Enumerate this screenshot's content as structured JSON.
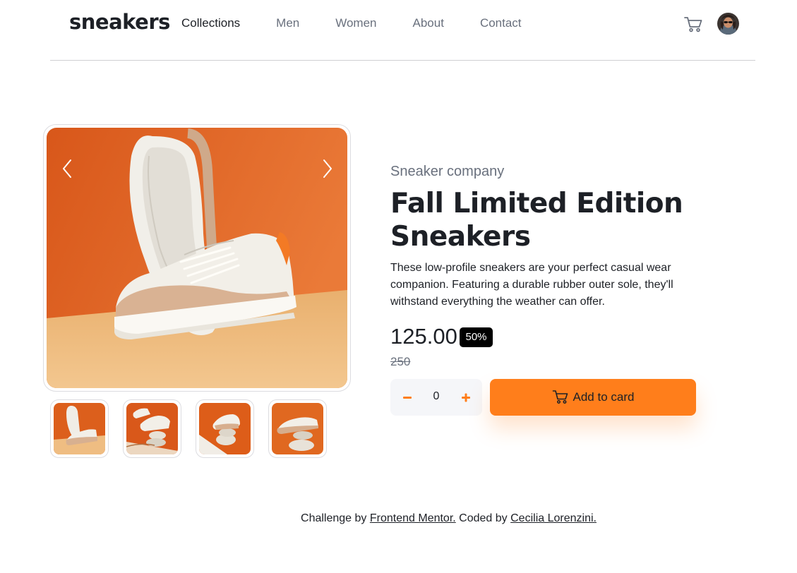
{
  "header": {
    "logo": "sneakers",
    "nav": [
      "Collections",
      "Men",
      "Women",
      "About",
      "Contact"
    ],
    "active_nav": "Collections"
  },
  "gallery": {
    "thumbnail_count": 4,
    "selected_thumbnail": 1
  },
  "product": {
    "company": "Sneaker company",
    "title": "Fall Limited Edition Sneakers",
    "description": "These low-profile sneakers are your perfect casual wear companion. Featuring a durable rubber outer sole, they'll withstand everything the weather can offer.",
    "price": "125.00",
    "discount": "50%",
    "original_price": "250",
    "quantity": "0",
    "add_button": "Add to card"
  },
  "footer": {
    "prefix": "Challenge by",
    "link1": "Frontend Mentor.",
    "middle": "Coded by",
    "link2": "Cecilia Lorenzini."
  },
  "colors": {
    "accent": "#ff7e1b",
    "text_dark": "#1d2026",
    "text_muted": "#69707d",
    "background_photo": "#e3631a"
  }
}
